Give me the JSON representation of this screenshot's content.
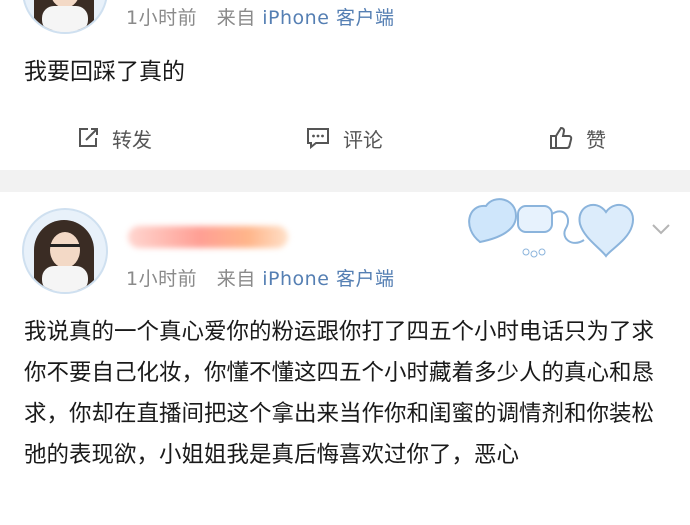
{
  "post1": {
    "meta_time": "1小时前",
    "meta_from": "来自",
    "meta_client": "iPhone 客户端",
    "content": "我要回踩了真的",
    "actions": {
      "forward_label": "转发",
      "comment_label": "评论",
      "like_label": "赞"
    }
  },
  "post2": {
    "meta_time": "1小时前",
    "meta_from": "来自",
    "meta_client": "iPhone 客户端",
    "content": "我说真的一个真心爱你的粉运跟你打了四五个小时电话只为了求你不要自己化妆，你懂不懂这四五个小时藏着多少人的真心和恳求，你却在直播间把这个拿出来当作你和闺蜜的调情剂和你装松弛的表现欲，小姐姐我是真后悔喜欢过你了，恶心"
  },
  "colors": {
    "client_link": "#557fb3",
    "meta_gray": "#8a8a8a",
    "separator": "#f2f2f2"
  }
}
